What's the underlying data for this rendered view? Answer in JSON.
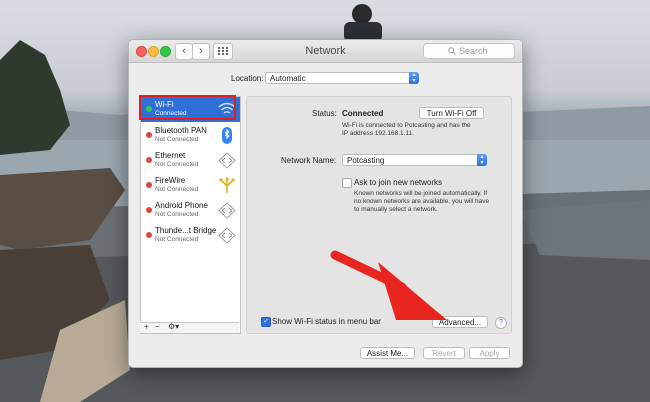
{
  "window": {
    "title": "Network",
    "search_placeholder": "Search",
    "back_glyph": "‹",
    "forward_glyph": "›"
  },
  "location": {
    "label": "Location:",
    "value": "Automatic"
  },
  "services": [
    {
      "name": "Wi-Fi",
      "status": "Connected",
      "dot": "#34c84a",
      "icon": "wifi-icon",
      "selected": true
    },
    {
      "name": "Bluetooth PAN",
      "status": "Not Connected",
      "dot": "#e0443e",
      "icon": "bluetooth-icon"
    },
    {
      "name": "Ethernet",
      "status": "Not Connected",
      "dot": "#e0443e",
      "icon": "ethernet-icon"
    },
    {
      "name": "FireWire",
      "status": "Not Connected",
      "dot": "#e0443e",
      "icon": "firewire-icon"
    },
    {
      "name": "Android Phone",
      "status": "Not Connected",
      "dot": "#e0443e",
      "icon": "ethernet-icon"
    },
    {
      "name": "Thunde...t Bridge",
      "status": "Not Connected",
      "dot": "#e0443e",
      "icon": "ethernet-icon"
    }
  ],
  "sidebar_controls": {
    "add": "+",
    "remove": "−",
    "gear": "⚙▾"
  },
  "status": {
    "label": "Status:",
    "value": "Connected",
    "toggle_button": "Turn Wi-Fi Off",
    "description_line1": "Wi-Fi is connected to Potcasting and has the",
    "description_line2": "IP address 192.168.1.11."
  },
  "network_name": {
    "label": "Network Name:",
    "value": "Potcasting"
  },
  "ask_join": {
    "label": "Ask to join new networks",
    "checked": false,
    "desc_line1": "Known networks will be joined automatically. If",
    "desc_line2": "no known networks are available, you will have",
    "desc_line3": "to manually select a network."
  },
  "menu_bar": {
    "label": "Show Wi-Fi status in menu bar",
    "checked": true
  },
  "buttons": {
    "advanced": "Advanced...",
    "help": "?",
    "assist": "Assist Me...",
    "revert": "Revert",
    "apply": "Apply"
  },
  "colors": {
    "selection": "#2e6fd8",
    "highlight_border": "#e0201c",
    "arrow": "#e8261f"
  }
}
